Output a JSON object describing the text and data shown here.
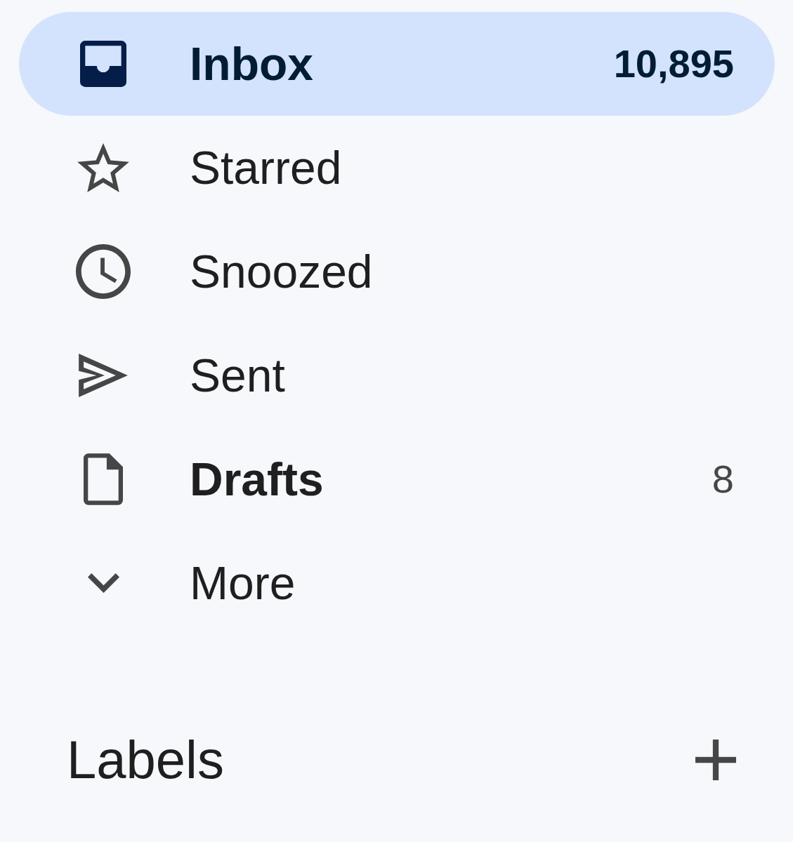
{
  "nav": {
    "items": [
      {
        "label": "Inbox",
        "count": "10,895",
        "selected": true,
        "unread": true
      },
      {
        "label": "Starred",
        "selected": false,
        "unread": false
      },
      {
        "label": "Snoozed",
        "selected": false,
        "unread": false
      },
      {
        "label": "Sent",
        "selected": false,
        "unread": false
      },
      {
        "label": "Drafts",
        "count": "8",
        "selected": false,
        "unread": true
      }
    ],
    "more": {
      "label": "More",
      "expanded": false
    }
  },
  "labels_section": {
    "title": "Labels"
  }
}
